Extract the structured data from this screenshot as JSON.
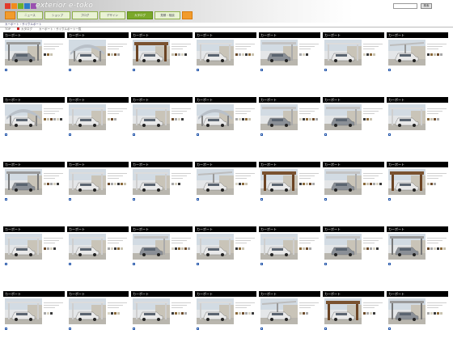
{
  "header": {
    "logo_colors": [
      "#e23a2a",
      "#f28a1c",
      "#6ab02e",
      "#2b7ac9",
      "#9a4fb0"
    ],
    "site_name": "exterior e-toko",
    "nav": [
      {
        "label": "",
        "kind": "icon"
      },
      {
        "label": "ニュース",
        "kind": "tab"
      },
      {
        "label": "ショップ",
        "kind": "tab"
      },
      {
        "label": "ブログ",
        "kind": "tab"
      },
      {
        "label": "デザイン",
        "kind": "tab"
      },
      {
        "label": "カタログ",
        "kind": "active"
      },
      {
        "label": "見積・相談",
        "kind": "tab"
      },
      {
        "label": "",
        "kind": "icon"
      }
    ],
    "search_button": "検索"
  },
  "subbar": {
    "link": "カーポート・サイクルポート"
  },
  "breadcrumb": [
    "TOP",
    "カタログ",
    "カーポート・サイクルポート一覧"
  ],
  "colors": {
    "header_bar": "#000000",
    "link": "#2255aa",
    "accent": "#7aa82a",
    "swatch_palette": [
      "#3a3a3a",
      "#8a6a3a",
      "#c8c2b0",
      "#6b4a2a",
      "#a8a8a8",
      "#d9d4c4"
    ]
  },
  "products": [
    {
      "title": "カーポート",
      "code": "",
      "scene": "steel-car"
    },
    {
      "title": "カーポート",
      "code": "",
      "scene": "arch-dome"
    },
    {
      "title": "カーポート",
      "code": "",
      "scene": "wood-frame"
    },
    {
      "title": "カーポート",
      "code": "",
      "scene": "white-car"
    },
    {
      "title": "カーポート",
      "code": "",
      "scene": "silver-car"
    },
    {
      "title": "カーポート",
      "code": "",
      "scene": "white-car"
    },
    {
      "title": "カーポート",
      "code": "",
      "scene": "flat-roof"
    },
    {
      "title": "カーポート",
      "code": "",
      "scene": "arch-dome"
    },
    {
      "title": "カーポート",
      "code": "",
      "scene": "white-car"
    },
    {
      "title": "カーポート",
      "code": "",
      "scene": "white-car"
    },
    {
      "title": "カーポート",
      "code": "",
      "scene": "arch-dome"
    },
    {
      "title": "カーポート",
      "code": "",
      "scene": "silver-car"
    },
    {
      "title": "カーポート",
      "code": "",
      "scene": "silver-car"
    },
    {
      "title": "カーポート",
      "code": "",
      "scene": "white-car"
    },
    {
      "title": "カーポート",
      "code": "",
      "scene": "steel-car"
    },
    {
      "title": "カーポート",
      "code": "",
      "scene": "white-car"
    },
    {
      "title": "カーポート",
      "code": "",
      "scene": "white-car"
    },
    {
      "title": "カーポート",
      "code": "",
      "scene": "flat-roof"
    },
    {
      "title": "カーポート",
      "code": "",
      "scene": "wood-frame"
    },
    {
      "title": "カーポート",
      "code": "",
      "scene": "silver-car"
    },
    {
      "title": "カーポート",
      "code": "",
      "scene": "wood-frame"
    },
    {
      "title": "カーポート",
      "code": "",
      "scene": "white-car"
    },
    {
      "title": "カーポート",
      "code": "",
      "scene": "white-car"
    },
    {
      "title": "カーポート",
      "code": "",
      "scene": "silver-car"
    },
    {
      "title": "カーポート",
      "code": "",
      "scene": "white-car"
    },
    {
      "title": "カーポート",
      "code": "",
      "scene": "white-car"
    },
    {
      "title": "カーポート",
      "code": "",
      "scene": "silver-car"
    },
    {
      "title": "カーポート",
      "code": "",
      "scene": "steel-car"
    },
    {
      "title": "カーポート",
      "code": "",
      "scene": "white-car"
    },
    {
      "title": "カーポート",
      "code": "",
      "scene": "white-car"
    },
    {
      "title": "カーポート",
      "code": "",
      "scene": "white-car"
    },
    {
      "title": "カーポート",
      "code": "",
      "scene": "white-car"
    },
    {
      "title": "カーポート",
      "code": "",
      "scene": "flat-roof"
    },
    {
      "title": "カーポート",
      "code": "",
      "scene": "wood-frame"
    },
    {
      "title": "カーポート",
      "code": "",
      "scene": "steel-car"
    }
  ],
  "card_link_label": "",
  "card_detail_label": ""
}
